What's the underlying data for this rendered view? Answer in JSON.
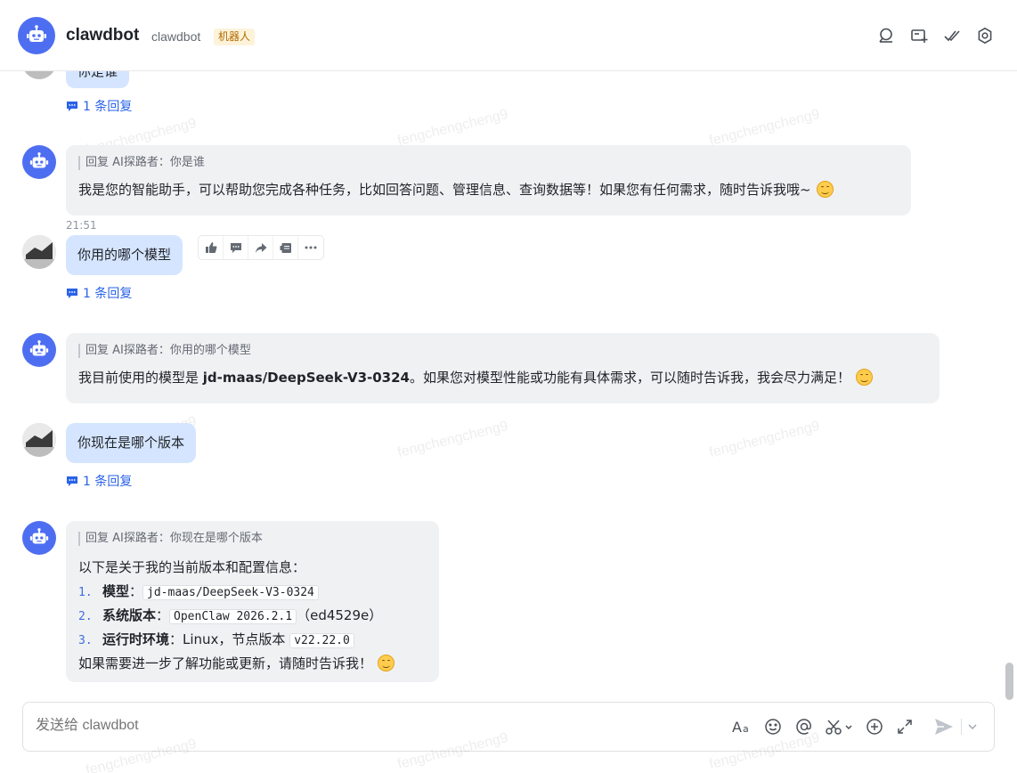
{
  "header": {
    "title": "clawdbot",
    "subtitle": "clawdbot",
    "badge": "机器人",
    "icons": [
      "search-icon",
      "add-chat-icon",
      "checkmarks-icon",
      "settings-icon"
    ]
  },
  "messages": [
    {
      "type": "user",
      "text": "你是谁",
      "reply_count_label": "1 条回复"
    },
    {
      "type": "bot",
      "quote": "回复 AI探路者：你是谁",
      "text": "我是您的智能助手，可以帮助您完成各种任务，比如回答问题、管理信息、查询数据等！如果您有任何需求，随时告诉我哦~"
    },
    {
      "type": "user",
      "time": "21:51",
      "text": "你用的哪个模型",
      "reply_count_label": "1 条回复"
    },
    {
      "type": "bot",
      "quote": "回复 AI探路者：你用的哪个模型",
      "text_before": "我目前使用的模型是 ",
      "text_bold": "jd-maas/DeepSeek-V3-0324",
      "text_after": "。如果您对模型性能或功能有具体需求，可以随时告诉我，我会尽力满足！"
    },
    {
      "type": "user",
      "text": "你现在是哪个版本",
      "reply_count_label": "1 条回复"
    },
    {
      "type": "bot",
      "quote": "回复 AI探路者：你现在是哪个版本",
      "intro": "以下是关于我的当前版本和配置信息：",
      "items": [
        {
          "num": "1.",
          "label": "模型",
          "sep": "：",
          "code": "jd-maas/DeepSeek-V3-0324",
          "suffix": ""
        },
        {
          "num": "2.",
          "label": "系统版本",
          "sep": "：",
          "code": "OpenClaw 2026.2.1",
          "suffix": "（ed4529e）"
        },
        {
          "num": "3.",
          "label": "运行时环境",
          "sep": "：Linux，节点版本 ",
          "code": "v22.22.0",
          "suffix": ""
        }
      ],
      "outro": "如果需要进一步了解功能或更新，请随时告诉我！"
    }
  ],
  "watermark": "fengchengcheng9",
  "composer": {
    "placeholder": "发送给 clawdbot",
    "icons": [
      "font-format-icon",
      "emoji-icon",
      "mention-icon",
      "screenshot-icon",
      "add-icon",
      "expand-icon",
      "send-icon"
    ]
  },
  "colors": {
    "accent": "#2a62e8",
    "bot_avatar": "#4e6ef2",
    "user_bubble": "#d5e5ff",
    "bot_bubble": "#f0f1f3"
  }
}
